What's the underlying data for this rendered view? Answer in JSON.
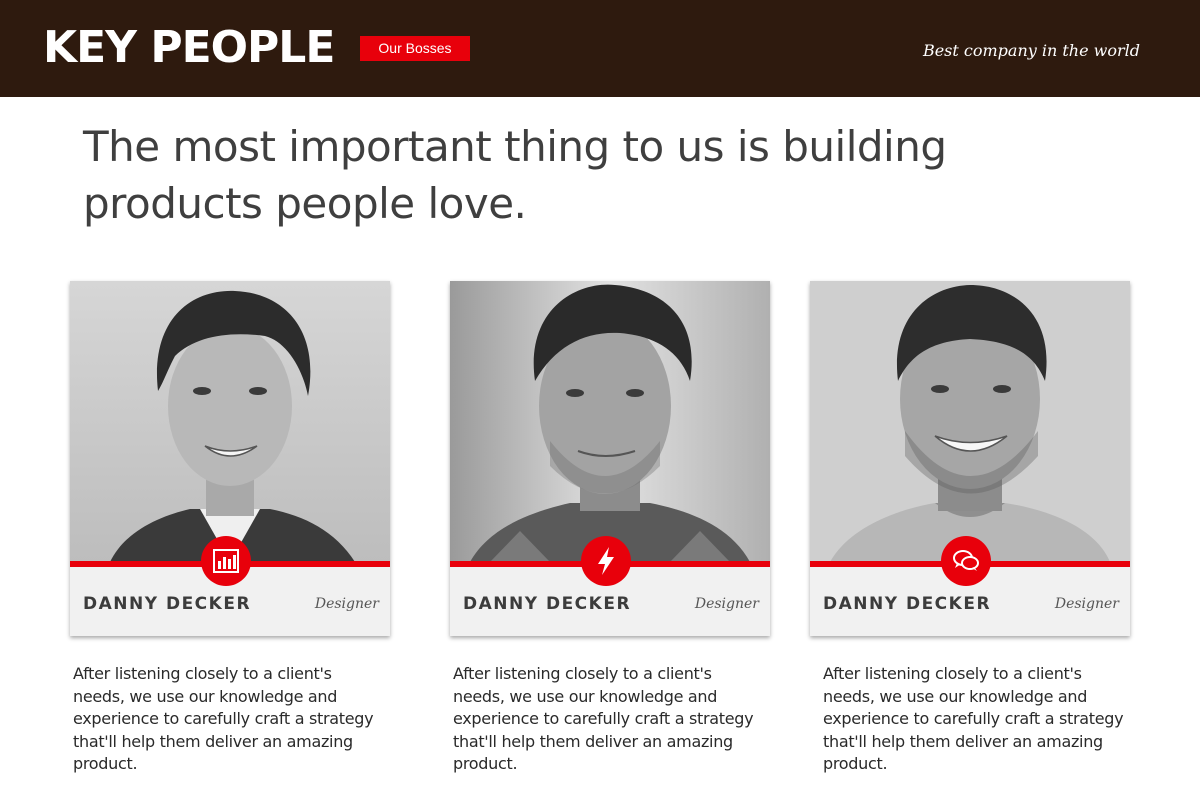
{
  "header": {
    "brand": "KEY PEOPLE",
    "badge": "Our Bosses",
    "tagline": "Best company in the world"
  },
  "headline": "The most important thing to us is building products people love.",
  "team": [
    {
      "name": "DANNY DECKER",
      "role": "Designer",
      "icon": "bar-chart-icon",
      "description": "After listening closely to a client's needs, we use our knowledge and experience to carefully craft a strategy that'll help them deliver an amazing product."
    },
    {
      "name": "DANNY DECKER",
      "role": "Designer",
      "icon": "lightning-bolt-icon",
      "description": "After listening closely to a client's needs, we use our knowledge and experience to carefully craft a strategy that'll help them deliver an amazing product."
    },
    {
      "name": "DANNY DECKER",
      "role": "Designer",
      "icon": "chat-bubbles-icon",
      "description": "After listening closely to a client's needs, we use our knowledge and experience to carefully craft a strategy that'll help them deliver an amazing product."
    }
  ],
  "colors": {
    "header_bg": "#2e1a0e",
    "accent": "#e8000b",
    "card_bg": "#f1f1f1"
  }
}
